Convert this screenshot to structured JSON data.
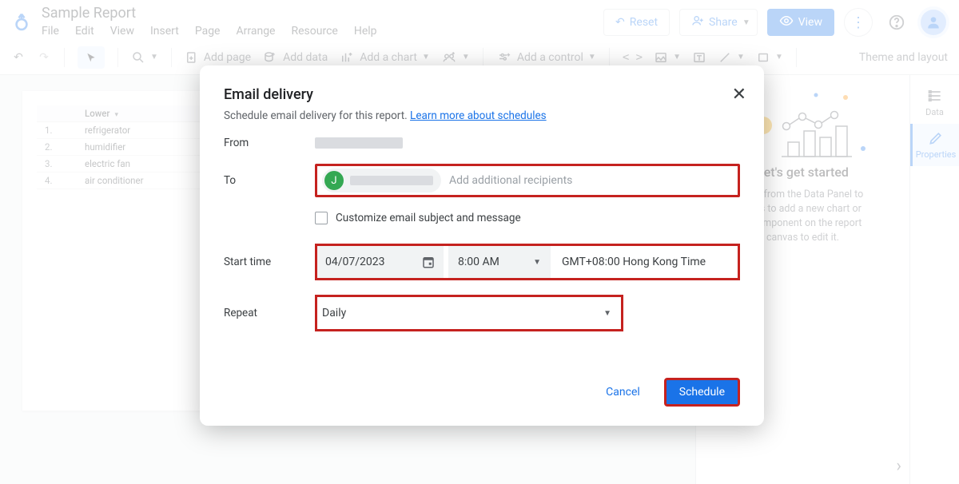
{
  "header": {
    "doc_title": "Sample Report",
    "menubar": [
      "File",
      "Edit",
      "View",
      "Insert",
      "Page",
      "Arrange",
      "Resource",
      "Help"
    ],
    "reset": "Reset",
    "share": "Share",
    "view": "View"
  },
  "toolbar": {
    "add_page": "Add page",
    "add_data": "Add data",
    "add_chart": "Add a chart",
    "add_control": "Add a control",
    "theme": "Theme and layout"
  },
  "table": {
    "col_header": "Lower",
    "rows": [
      "refrigerator",
      "humidifier",
      "electric fan",
      "air conditioner"
    ]
  },
  "right_panel": {
    "title": "Let's get started",
    "body_line1": "field from the Data Panel to",
    "body_line2": "nvas to add a new chart or",
    "body_line3": "a component on the report",
    "body_line4": "canvas to edit it."
  },
  "side_tabs": {
    "data": "Data",
    "properties": "Properties"
  },
  "modal": {
    "title": "Email delivery",
    "subtitle_prefix": "Schedule email delivery for this report. ",
    "subtitle_link": "Learn more about schedules",
    "labels": {
      "from": "From",
      "to": "To",
      "start": "Start time",
      "repeat": "Repeat"
    },
    "recipient_initial": "J",
    "recipient_hint": "Add additional recipients",
    "customize_label": "Customize email subject and message",
    "date": "04/07/2023",
    "time": "8:00 AM",
    "timezone": "GMT+08:00 Hong Kong Time",
    "repeat_value": "Daily",
    "cancel": "Cancel",
    "schedule": "Schedule"
  }
}
